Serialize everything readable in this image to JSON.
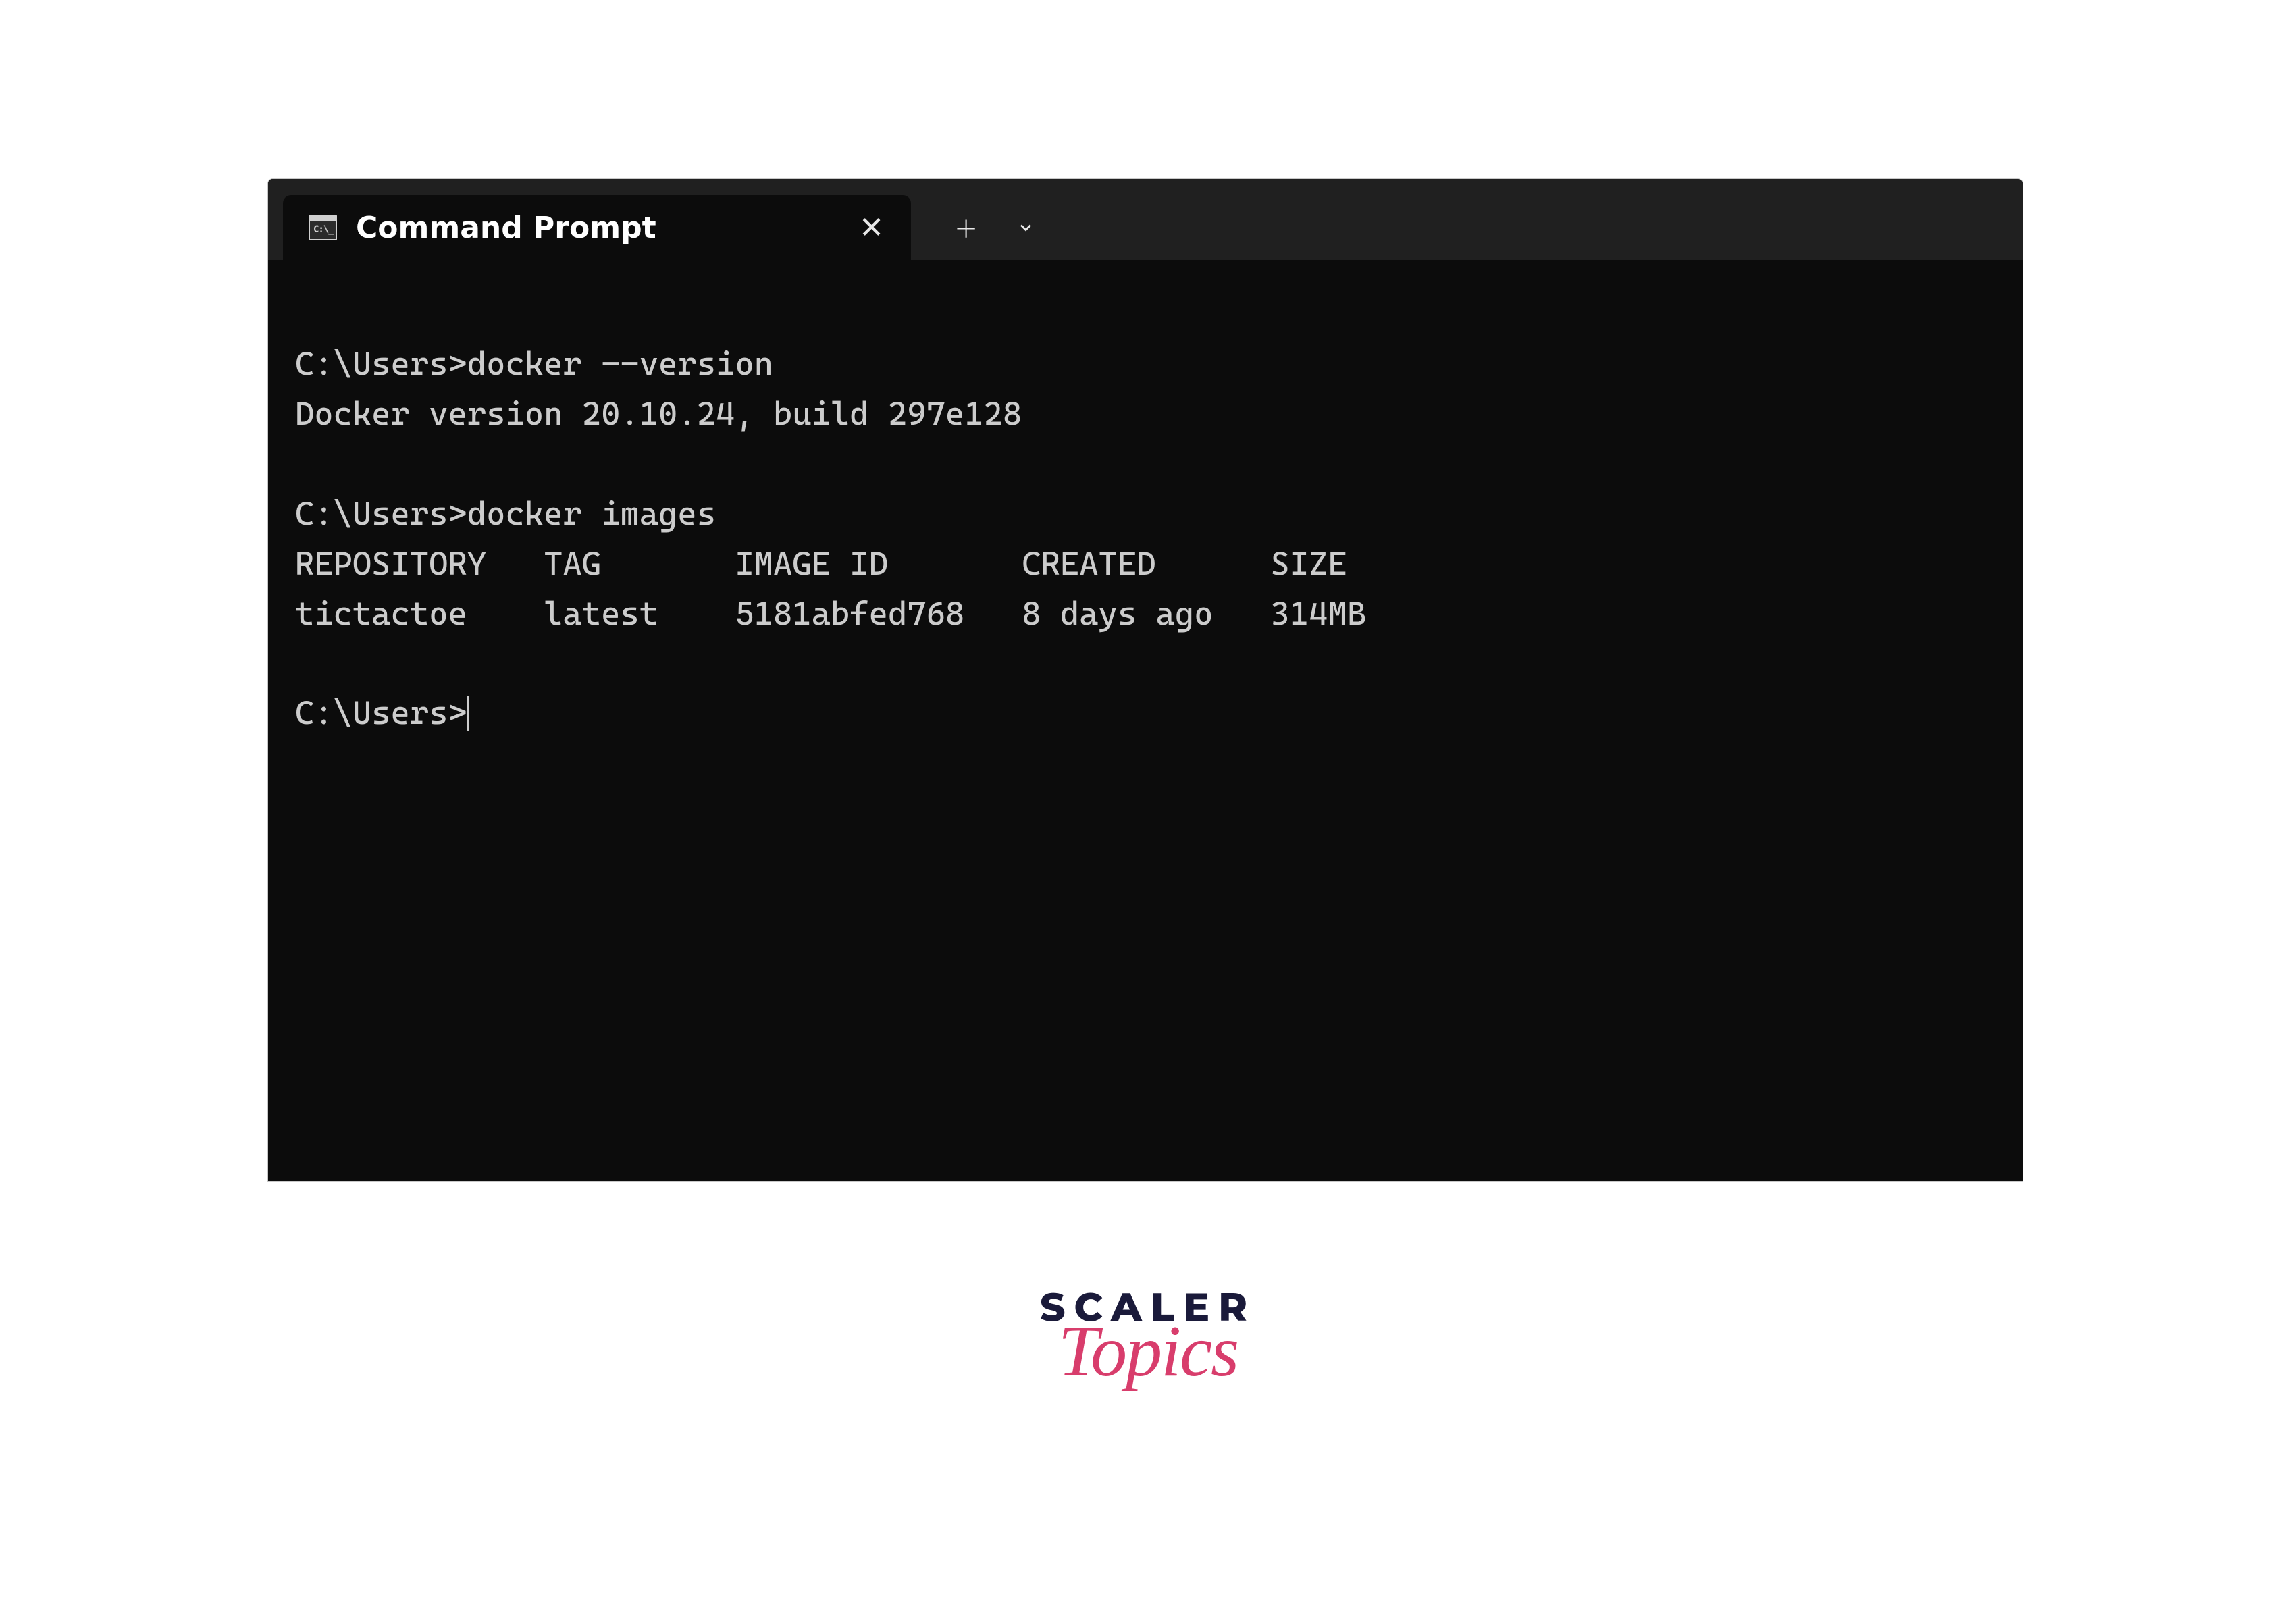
{
  "window": {
    "tab_title": "Command Prompt"
  },
  "terminal": {
    "lines": [
      "C:\\Users>docker --version",
      "Docker version 20.10.24, build 297e128",
      "",
      "C:\\Users>docker images",
      "REPOSITORY   TAG       IMAGE ID       CREATED      SIZE",
      "tictactoe    latest    5181abfed768   8 days ago   314MB",
      "",
      "C:\\Users>"
    ]
  },
  "logo": {
    "line1": "SCALER",
    "line2": "Topics"
  }
}
